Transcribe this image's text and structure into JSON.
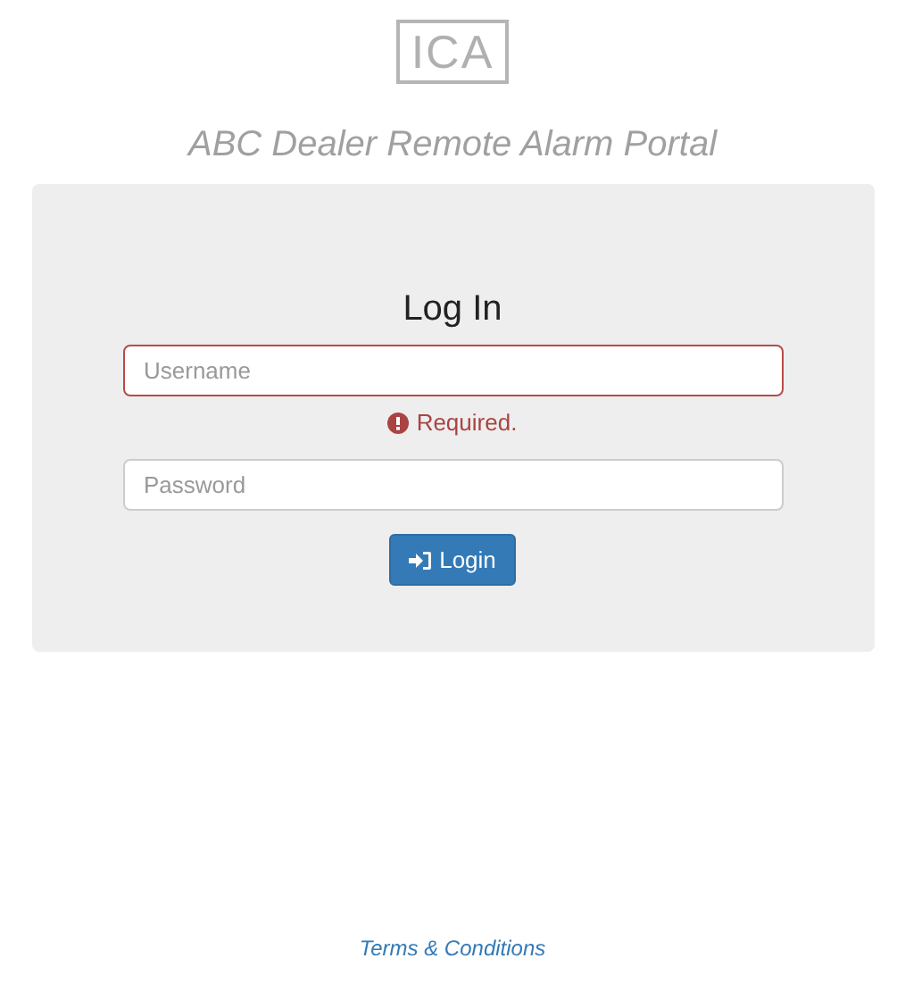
{
  "logo": {
    "text": "ICA"
  },
  "title": "ABC Dealer Remote Alarm Portal",
  "form": {
    "heading": "Log In",
    "fields": [
      {
        "placeholder": "Username",
        "invalid": true,
        "error": "Required."
      },
      {
        "placeholder": "Password",
        "invalid": false
      }
    ],
    "button": "Login"
  },
  "footer_link": "Terms & Conditions"
}
